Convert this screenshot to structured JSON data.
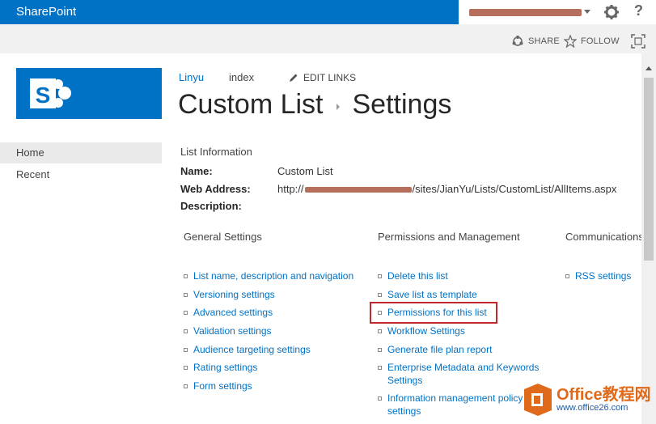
{
  "suite_bar": {
    "brand": "SharePoint",
    "help_label": "?"
  },
  "action_bar": {
    "share_label": "SHARE",
    "follow_label": "FOLLOW"
  },
  "quick_launch": {
    "items": [
      {
        "label": "Home",
        "selected": true
      },
      {
        "label": "Recent",
        "selected": false
      }
    ]
  },
  "top_links": {
    "site_name": "Linyu",
    "index": "index",
    "edit_links": "EDIT LINKS"
  },
  "page_title": {
    "parent": "Custom List",
    "current": "Settings"
  },
  "list_information": {
    "header": "List Information",
    "name_label": "Name:",
    "name_value": "Custom List",
    "web_address_label": "Web Address:",
    "web_address_prefix": "http://",
    "web_address_suffix": "/sites/JianYu/Lists/CustomList/AllItems.aspx",
    "description_label": "Description:"
  },
  "sections": {
    "general": {
      "header": "General Settings",
      "links": [
        "List name, description and navigation",
        "Versioning settings",
        "Advanced settings",
        "Validation settings",
        "Audience targeting settings",
        "Rating settings",
        "Form settings"
      ]
    },
    "permissions": {
      "header": "Permissions and Management",
      "links": [
        "Delete this list",
        "Save list as template",
        "Permissions for this list",
        "Workflow Settings",
        "Generate file plan report",
        "Enterprise Metadata and Keywords Settings",
        "Information management policy settings"
      ]
    },
    "communications": {
      "header": "Communications",
      "links": [
        "RSS settings"
      ]
    }
  },
  "watermark": {
    "main": "Office教程网",
    "sub": "www.office26.com"
  },
  "colors": {
    "brand_blue": "#0072c6",
    "link_blue": "#0072c6",
    "highlight_red": "#c0282c"
  }
}
